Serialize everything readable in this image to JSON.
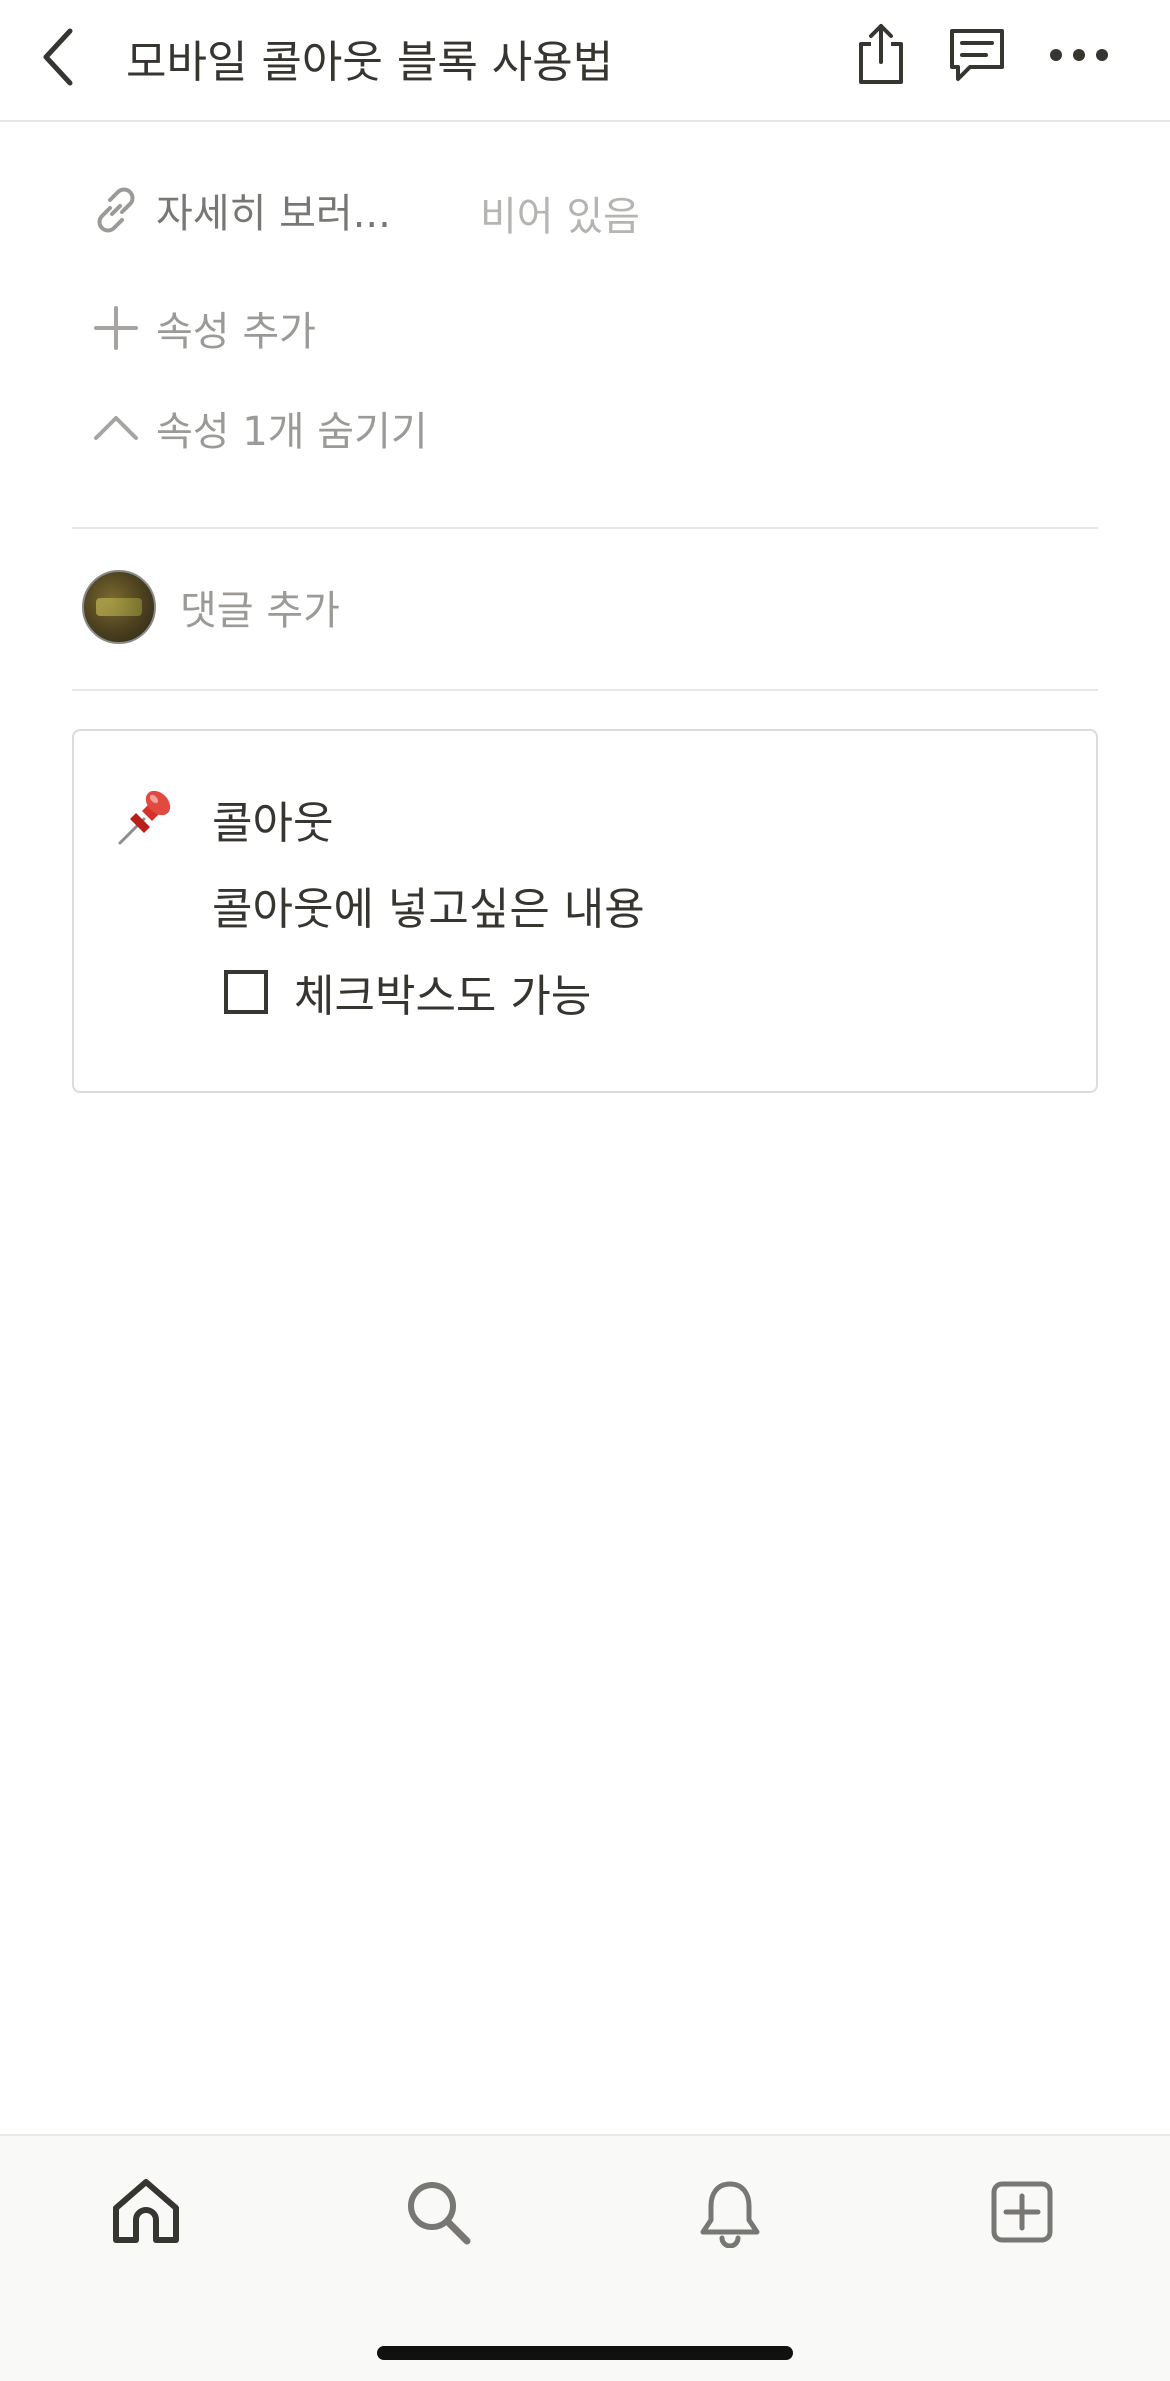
{
  "header": {
    "title": "모바일 콜아웃 블록 사용법",
    "back_icon": "chevron-left-icon",
    "share_icon": "share-icon",
    "comments_icon": "comment-icon",
    "more_icon": "more-horizontal-icon"
  },
  "properties": [
    {
      "icon": "link-icon",
      "label": "자세히 보러...",
      "value": "비어 있음"
    }
  ],
  "add_property_label": "속성 추가",
  "hide_properties_label": "속성 1개 숨기기",
  "comment": {
    "avatar_icon": "user-avatar",
    "placeholder": "댓글 추가"
  },
  "callout": {
    "icon": "pushpin-icon",
    "title": "콜아웃",
    "body": "콜아웃에 넣고싶은 내용",
    "todo": {
      "text": "체크박스도 가능",
      "checked": false
    }
  },
  "tabbar": {
    "items": [
      {
        "name": "home",
        "icon": "home-icon"
      },
      {
        "name": "search",
        "icon": "search-icon"
      },
      {
        "name": "notifications",
        "icon": "bell-icon"
      },
      {
        "name": "new-page",
        "icon": "plus-square-icon"
      }
    ]
  },
  "colors": {
    "text": "#37352f",
    "muted": "#9b9a97",
    "divider": "#e6e6e4",
    "pin_red": "#d8312a",
    "tabbar_bg": "#f9f9f8"
  }
}
